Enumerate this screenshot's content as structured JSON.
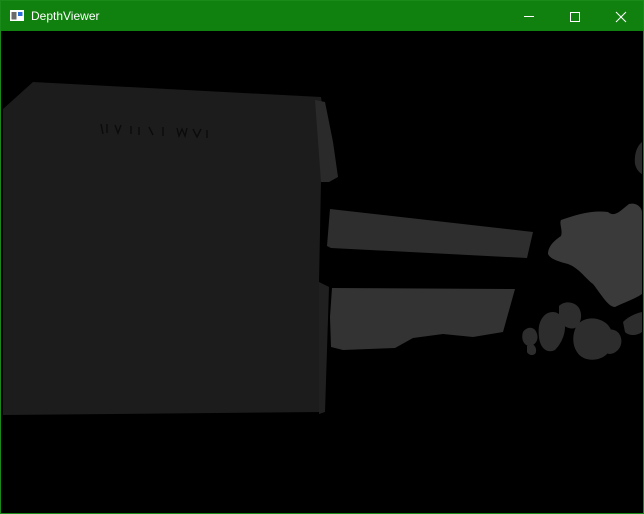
{
  "window": {
    "title": "DepthViewer",
    "titlebar_color": "#10800e",
    "border_color": "#1a8a1a"
  },
  "icons": {
    "app": "app-window-icon",
    "minimize": "minimize-icon",
    "maximize": "maximize-icon",
    "close": "close-icon"
  },
  "viewport": {
    "content": "depth-image",
    "background": "#000000"
  }
}
